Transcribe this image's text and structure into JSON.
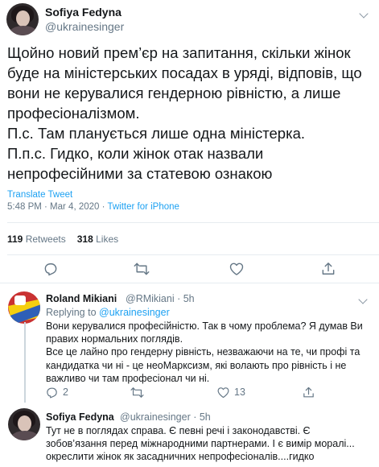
{
  "main_tweet": {
    "author_name": "Sofiya Fedyna",
    "author_handle": "@ukrainesinger",
    "lines": [
      "Щойно новий прем’єр на запитання, скільки жінок",
      "буде на міністерських посадах в уряді, відповів, що",
      "вони не керувалися гендерною рівністю, а лише",
      "професіоналізмом.",
      "П.с. Там планується лише одна міністерка.",
      "П.п.с. Гидко, коли жінок отак назвали",
      "непрофесійними за статевою ознакою"
    ],
    "translate_label": "Translate Tweet",
    "time": "5:48 PM · Mar 4, 2020 · ",
    "source": "Twitter for iPhone",
    "retweets_count": "119",
    "retweets_label": "Retweets",
    "likes_count": "318",
    "likes_label": "Likes"
  },
  "replies": [
    {
      "author_name": "Roland Mikiani",
      "author_handle": "@RMikiani · 5h",
      "replying_prefix": "Replying to ",
      "replying_to": "@ukrainesinger",
      "lines": [
        "Вони керувалися професійністю. Так в чому проблема? Я думав Ви",
        "правих нормальних поглядів.",
        "Все це лайно про гендерну рівність, незважаючи на те, чи профі та",
        "кандидатка чи ні - це неоМарксизм, які волають про рівність і не",
        "важливо чи там професіонал чи ні."
      ],
      "reply_count": "2",
      "like_count": "13"
    },
    {
      "author_name": "Sofiya Fedyna",
      "author_handle": "@ukrainesinger · 5h",
      "lines": [
        "Тут не в поглядах справа. Є певні речі і законодавстві. Є",
        "зобов’язання перед міжнародними партнерами. І є вимір моралі...",
        "окреслити жінок як засадничних непрофесіоналів....гидко"
      ]
    }
  ],
  "icons": {
    "reply": "reply-icon",
    "retweet": "retweet-icon",
    "like": "heart-icon",
    "share": "share-icon",
    "more": "chevron-down-icon"
  },
  "colors": {
    "accent": "#1da1f2",
    "secondary_text": "#657786",
    "divider": "#e6ecf0"
  }
}
